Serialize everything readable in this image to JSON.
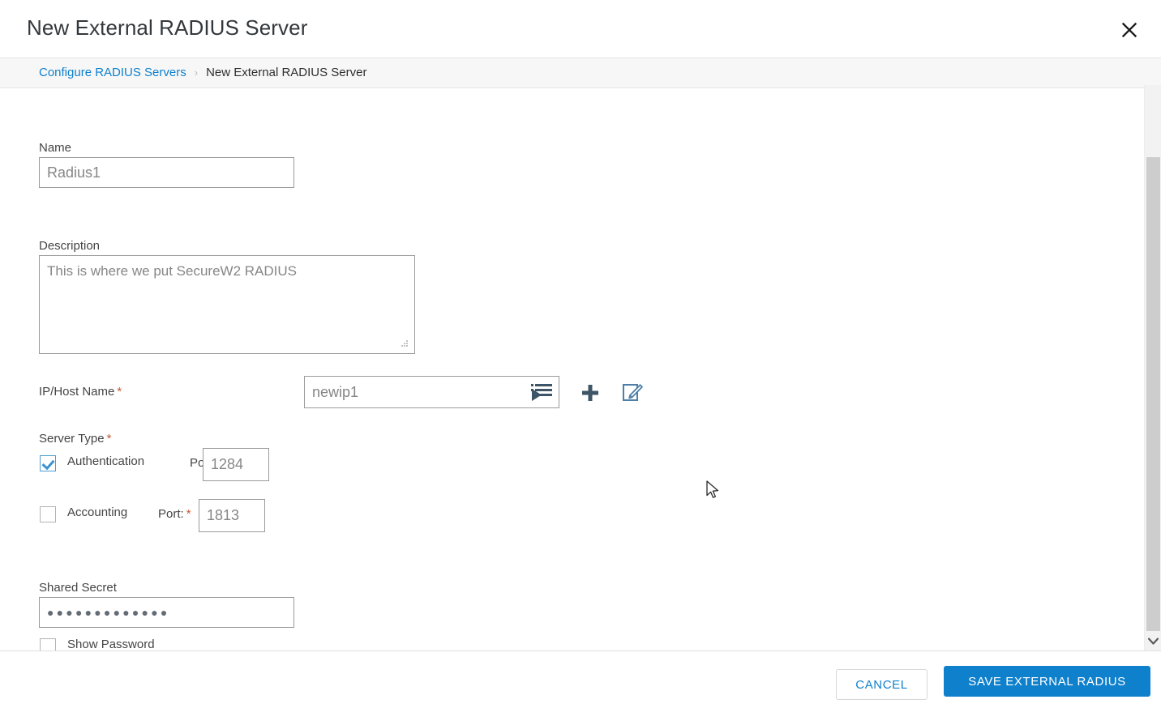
{
  "dialog": {
    "title": "New External RADIUS Server",
    "close_icon": "close-icon"
  },
  "breadcrumb": {
    "parent": "Configure RADIUS Servers",
    "separator": "›",
    "current": "New External RADIUS Server"
  },
  "form": {
    "name": {
      "label": "Name",
      "value": "Radius1",
      "placeholder": ""
    },
    "description": {
      "label": "Description",
      "value": "This is where we put SecureW2 RADIUS",
      "placeholder": ""
    },
    "ip_host_name": {
      "label": "IP/Host Name",
      "required_marker": "*",
      "value": "newip1",
      "placeholder": "",
      "picker_icon": "list-select-icon",
      "add_icon": "plus-icon",
      "edit_icon": "edit-pencil-icon"
    },
    "server_type": {
      "label": "Server Type",
      "required_marker": "*",
      "authentication": {
        "label": "Authentication",
        "checked": true,
        "port_label": "Port:",
        "port_required_marker": "*",
        "port_value": "1284"
      },
      "accounting": {
        "label": "Accounting",
        "checked": false,
        "port_label": "Port:",
        "port_required_marker": "*",
        "port_value": "1813"
      }
    },
    "shared_secret": {
      "label": "Shared Secret",
      "value": "●●●●●●●●●●●●●",
      "show_password_label": "Show Password",
      "show_password_checked": false
    }
  },
  "scrollbar": {
    "down_arrow_icon": "chevron-down-icon"
  },
  "footer": {
    "cancel_label": "CANCEL",
    "save_label": "SAVE EXTERNAL RADIUS"
  },
  "colors": {
    "accent_blue": "#0f80cc",
    "link_blue": "#0f80cc",
    "required_star": "#c25b34",
    "checkbox_blue": "#3e92d0",
    "icon_slate": "#3d5566",
    "band_background": "#f7f7f7",
    "scrollbar_thumb": "#cdcdcd"
  }
}
